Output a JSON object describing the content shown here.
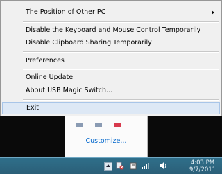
{
  "menu": {
    "items": [
      {
        "label": "The Position of Other PC"
      },
      {
        "label": "Disable the Keyboard and Mouse Control Temporarily"
      },
      {
        "label": "Disable Clipboard Sharing Temporarily"
      },
      {
        "label": "Preferences"
      },
      {
        "label": "Online Update"
      },
      {
        "label": "About USB Magic Switch..."
      },
      {
        "label": "Exit"
      }
    ]
  },
  "tray_panel": {
    "customize_label": "Customize..."
  },
  "clock": {
    "time": "4:03 PM",
    "date": "9/7/2011"
  }
}
